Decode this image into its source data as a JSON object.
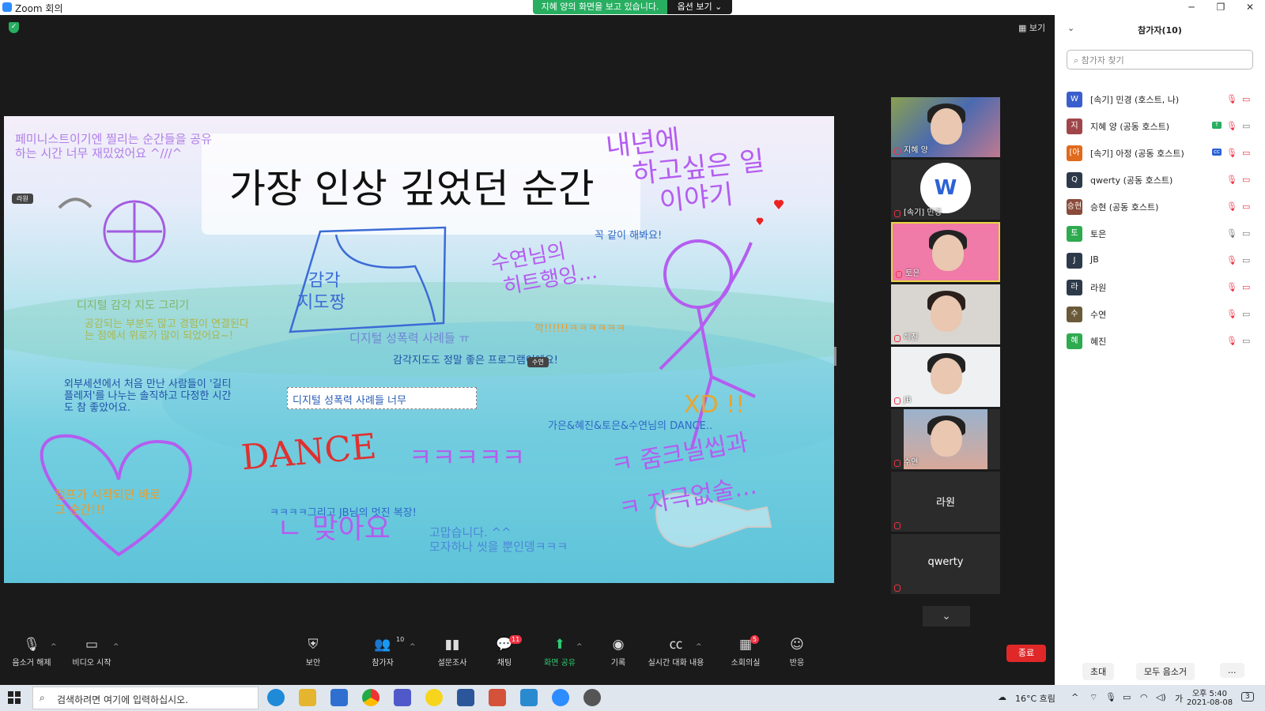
{
  "window": {
    "title": "Zoom 회의",
    "share_banner": "지혜 양의 화면을 보고 있습니다.",
    "view_options": "옵션 보기 ⌄",
    "minimize": "─",
    "maximize": "❐",
    "close": "✕"
  },
  "stage": {
    "gallery_label": "▦ 보기"
  },
  "board": {
    "title": "가장 인상 깊었던 순간",
    "notes": {
      "n1": "페미니스트이기엔 찔리는 순간들을 공유",
      "n1b": "하는 시간 너무 재밌었어요 ^///^",
      "n2": "디지털 감각 지도 그리기",
      "n3": "공감되는 부분도 많고 경험이 연결된다",
      "n3b": "는 점에서 위로가 많이 되었어요~!",
      "n4": "외부세션에서 처음 만난 사람들이 '길티",
      "n4b": "플레저'를 나누는 솔직하고 다정한 시간",
      "n4c": "도 참 좋았어요.",
      "n5": "디지털 성폭력 사례들 ㅠ",
      "n6": "감각지도도 정말 좋은 프로그램이에요!",
      "n7": "꼭 같이 해봐요!",
      "n8": "깍!!!!!!ㅋㅋㅋㅋㅋㅋ",
      "n9": "가은&혜진&토은&수연님의 DANCE..",
      "n10": "ㅋㅋㅋㅋ그리고 JB님의 멋진 복장!",
      "n11": "고맙습니다. ^^",
      "n11b": "모자하나 씻을 뿐인뎅ㅋㅋㅋ",
      "n12": "캠프가 시작되던 바로",
      "n12b": "그 순간!!!",
      "hand1": "내년에",
      "hand2": "하고싶은 일",
      "hand3": "이야기",
      "hand4": "수연님의",
      "hand5": "히트행잉...",
      "hand6": "감각",
      "hand7": "지도짱",
      "hand8": "DANCE",
      "hand9": "ㅋㅋㅋㅋㅋ",
      "hand10": "ㄴ 맞아요",
      "hand11": "XD !!",
      "hand12": "ㅋ 줌크닐씹과",
      "hand13": "ㅋ 자극없술..."
    },
    "tags": {
      "t1": "라원",
      "t2": "수연"
    },
    "textbox": "디지털 성폭력 사례들 너무"
  },
  "tiles": [
    {
      "name": "지혜 양"
    },
    {
      "name": "[속기] 민경"
    },
    {
      "name": "토은"
    },
    {
      "name": "혜진"
    },
    {
      "name": "JB"
    },
    {
      "name": "수연"
    },
    {
      "name": "라원"
    },
    {
      "name": "qwerty"
    }
  ],
  "toolbar": {
    "mute": "음소거 해제",
    "video": "비디오 시작",
    "security": "보안",
    "participants": "참가자",
    "participants_count": "10",
    "poll": "설문조사",
    "chat": "채팅",
    "chat_badge": "11",
    "share": "화면 공유",
    "record": "기록",
    "captions": "실시간 대화 내용",
    "breakout": "소회의실",
    "breakout_badge": "5",
    "reactions": "반응",
    "end": "종료"
  },
  "panel": {
    "title": "참가자(10)",
    "search_placeholder": "참가자 찾기",
    "participants": [
      {
        "name": "[속기] 민경 (호스트, 나)",
        "avatar": "W",
        "color": "#3a5fcd"
      },
      {
        "name": "지혜 양 (공동 호스트)",
        "avatar": "지",
        "color": "#a0464a"
      },
      {
        "name": "[속기] 아정 (공동 호스트)",
        "avatar": "[아",
        "color": "#e06a1c"
      },
      {
        "name": "qwerty (공동 호스트)",
        "avatar": "Q",
        "color": "#2d3a4a"
      },
      {
        "name": "승현 (공동 호스트)",
        "avatar": "승현",
        "color": "#8a4b3a"
      },
      {
        "name": "토은",
        "avatar": "토",
        "color": "#2eaa4f"
      },
      {
        "name": "JB",
        "avatar": "J",
        "color": "#2d3a4a"
      },
      {
        "name": "라원",
        "avatar": "라",
        "color": "#2d3a4a"
      },
      {
        "name": "수연",
        "avatar": "수",
        "color": "#6b5a3a"
      },
      {
        "name": "혜진",
        "avatar": "혜",
        "color": "#2eaa4f"
      }
    ],
    "invite": "초대",
    "mute_all": "모두 음소거",
    "more": "..."
  },
  "taskbar": {
    "search": "검색하려면 여기에 입력하십시오.",
    "weather": "16°C 흐림",
    "time": "오후 5:40",
    "date": "2021-08-08",
    "ime": "가",
    "notify": "3"
  }
}
